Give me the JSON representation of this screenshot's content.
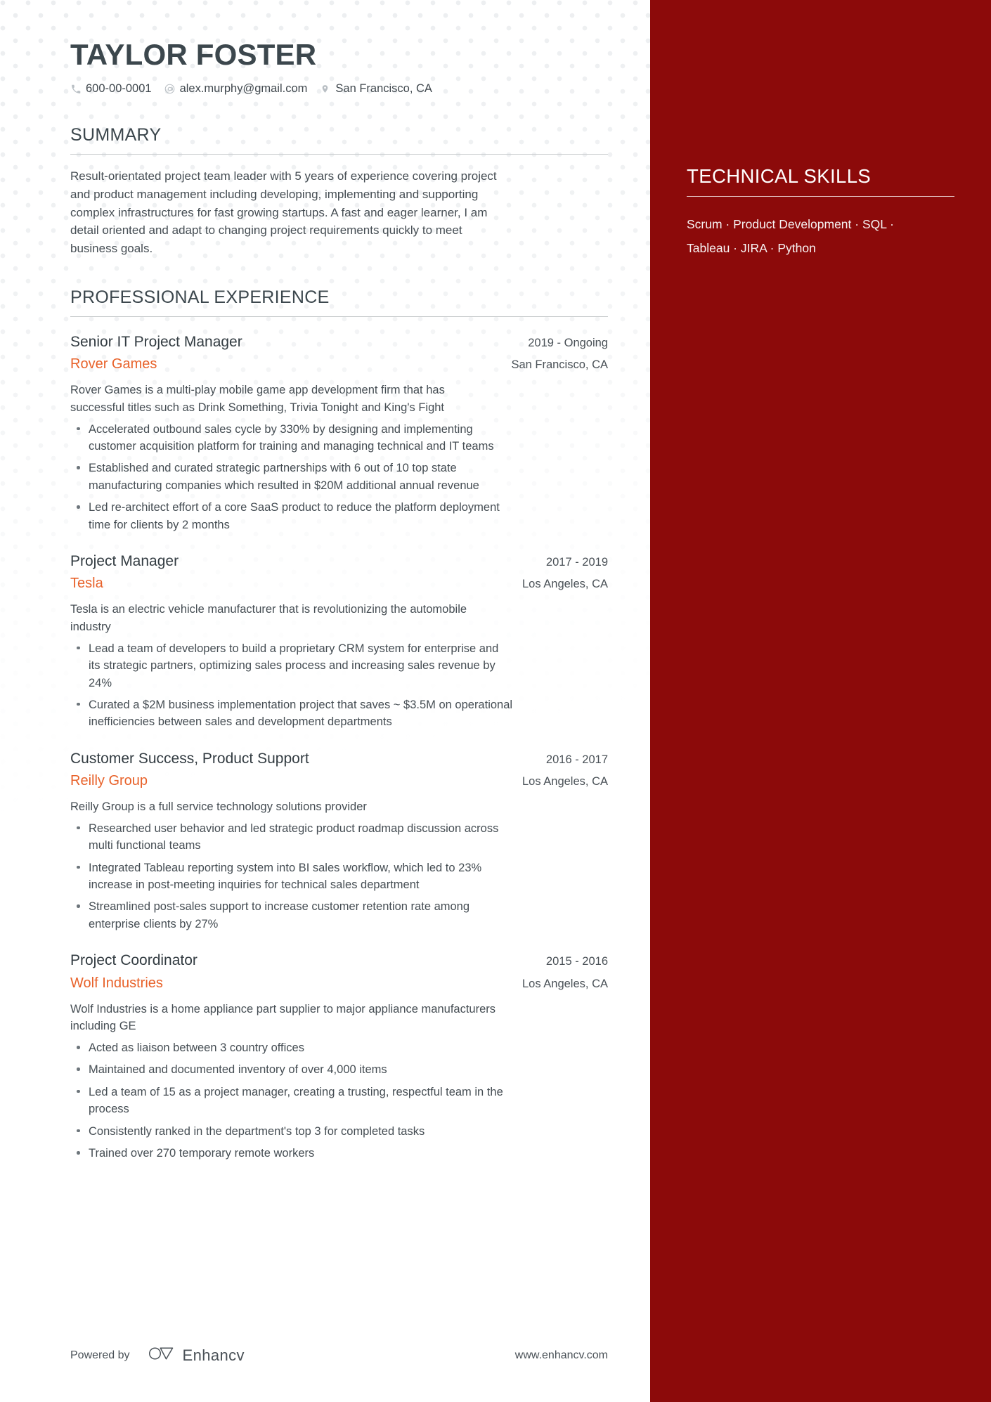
{
  "header": {
    "name": "TAYLOR FOSTER",
    "contacts": [
      {
        "icon": "phone-icon",
        "text": "600-00-0001"
      },
      {
        "icon": "email-icon",
        "text": "alex.murphy@gmail.com"
      },
      {
        "icon": "location-icon",
        "text": "San Francisco, CA"
      }
    ]
  },
  "summary": {
    "heading": "SUMMARY",
    "text": "Result-orientated project team leader with 5 years of experience covering project and product management including developing, implementing and supporting complex infrastructures for fast growing startups. A fast and eager learner, I am detail oriented and adapt to changing project requirements quickly to meet business goals."
  },
  "experience": {
    "heading": "PROFESSIONAL EXPERIENCE",
    "jobs": [
      {
        "title": "Senior IT Project Manager",
        "date": "2019 - Ongoing",
        "company": "Rover Games",
        "location": "San Francisco, CA",
        "description": "Rover Games is a multi-play mobile game app development firm that has successful titles such as Drink Something, Trivia Tonight and King's Fight",
        "bullets": [
          "Accelerated outbound sales cycle by 330% by designing and implementing customer acquisition platform for training and managing technical and IT teams",
          "Established and curated strategic partnerships with 6 out of 10 top state manufacturing companies which resulted in $20M additional annual revenue",
          "Led re-architect effort of a core SaaS product to reduce the platform deployment time for clients by 2 months"
        ]
      },
      {
        "title": "Project Manager",
        "date": "2017 - 2019",
        "company": "Tesla",
        "location": "Los Angeles, CA",
        "description": "Tesla is an electric vehicle manufacturer that is revolutionizing the automobile industry",
        "bullets": [
          "Lead a team of developers to build a proprietary CRM system for enterprise and its strategic partners, optimizing sales process and increasing sales revenue by 24%",
          "Curated a $2M business implementation project that saves ~ $3.5M on operational inefficiencies between sales and development departments"
        ]
      },
      {
        "title": "Customer Success, Product Support",
        "date": "2016 - 2017",
        "company": "Reilly Group",
        "location": "Los Angeles, CA",
        "description": "Reilly Group is a full service technology solutions provider",
        "bullets": [
          "Researched user behavior and led strategic product roadmap discussion across multi functional teams",
          "Integrated Tableau reporting system into BI sales workflow, which led to 23% increase in post-meeting inquiries for technical sales department",
          "Streamlined post-sales support to increase customer retention rate among enterprise clients by 27%"
        ]
      },
      {
        "title": "Project Coordinator",
        "date": "2015 - 2016",
        "company": "Wolf Industries",
        "location": "Los Angeles, CA",
        "description": "Wolf Industries is a home appliance part supplier to major appliance manufacturers including GE",
        "bullets": [
          "Acted as liaison between 3 country offices",
          "Maintained and documented inventory of over 4,000 items",
          "Led a team of 15 as a project manager, creating a trusting, respectful team in the process",
          "Consistently ranked in the department's top 3 for completed tasks",
          "Trained over 270 temporary remote workers"
        ]
      }
    ]
  },
  "sidebar": {
    "heading": "TECHNICAL SKILLS",
    "skills_lines": [
      "Scrum · Product Development · SQL ·",
      "Tableau · JIRA · Python"
    ]
  },
  "footer": {
    "powered_by": "Powered by",
    "brand": "Enhancv",
    "website": "www.enhancv.com"
  },
  "colors": {
    "sidebar_bg": "#8c0a0a",
    "company_accent": "#e8622a",
    "heading": "#3c474d",
    "body_text": "#454d53"
  }
}
